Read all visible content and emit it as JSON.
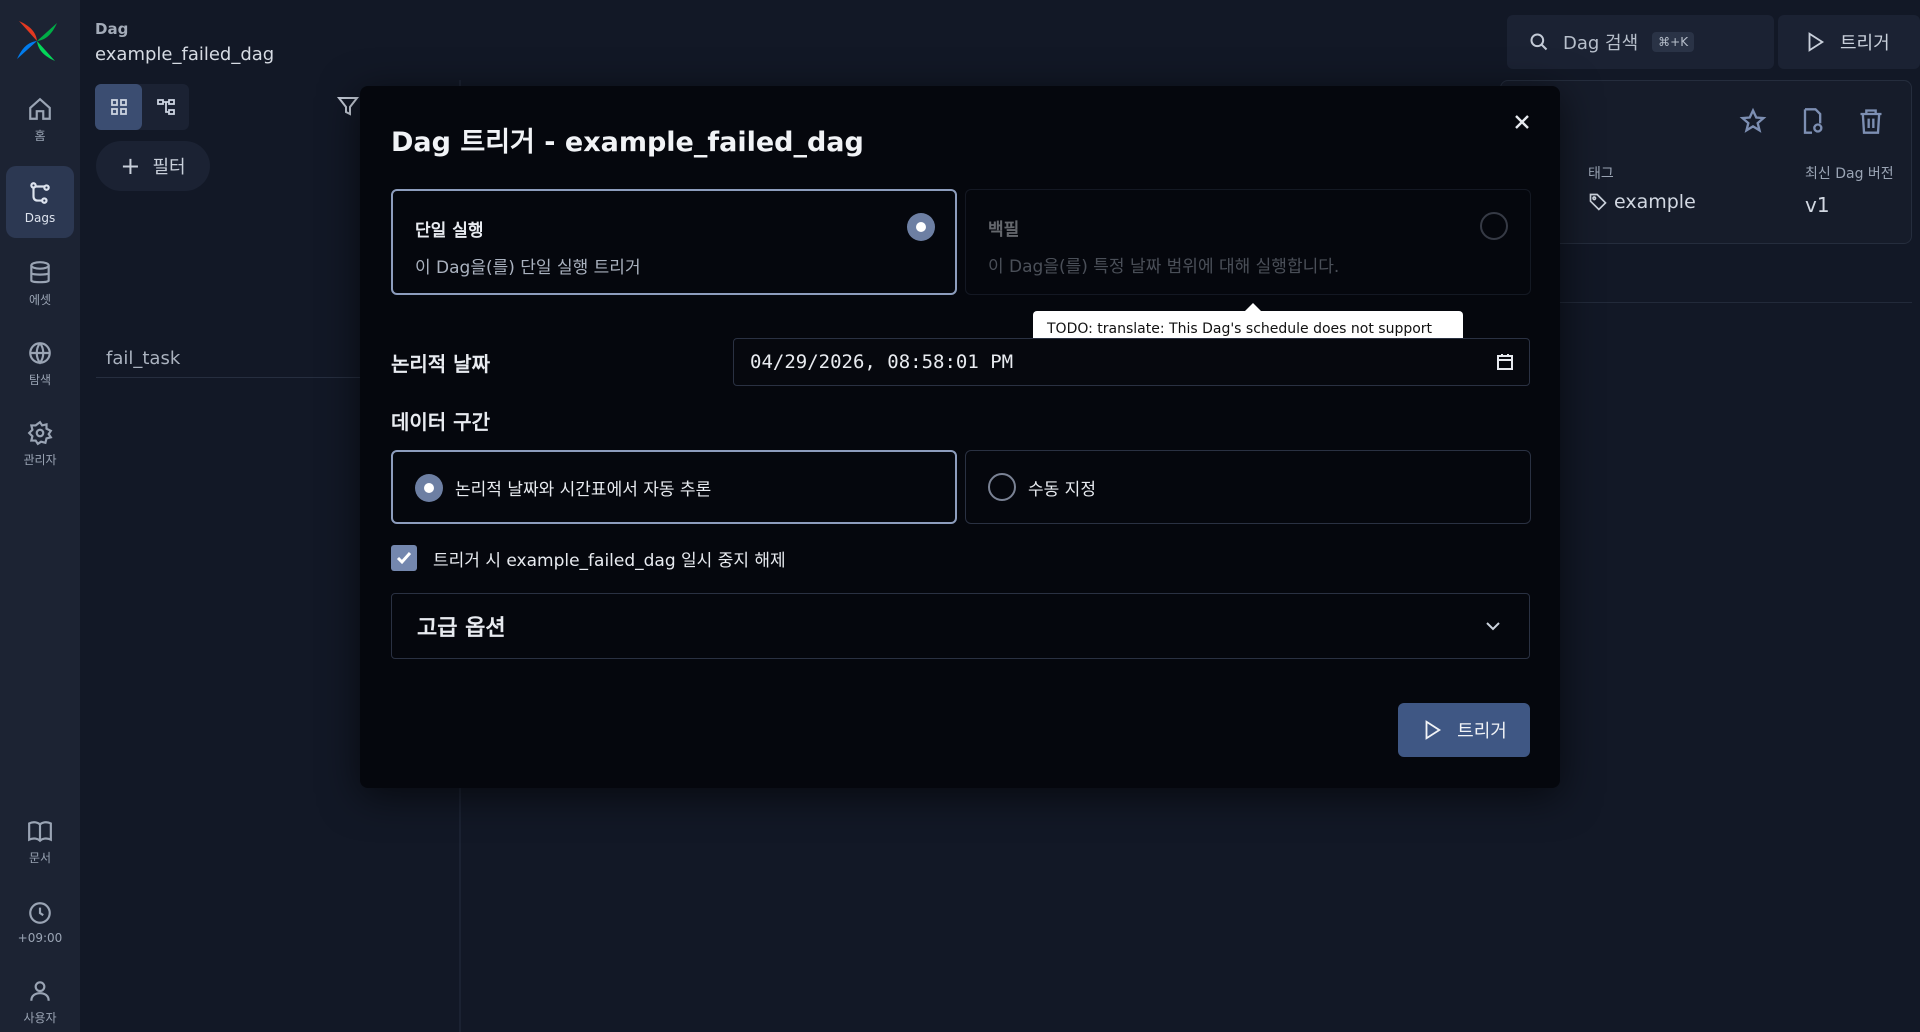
{
  "sidebar": {
    "items": [
      {
        "label": "홈",
        "icon": "home-icon"
      },
      {
        "label": "Dags",
        "icon": "dag-icon"
      },
      {
        "label": "에셋",
        "icon": "database-icon"
      },
      {
        "label": "탐색",
        "icon": "globe-icon"
      },
      {
        "label": "관리자",
        "icon": "gear-icon"
      },
      {
        "label": "문서",
        "icon": "book-icon"
      },
      {
        "label": "+09:00",
        "icon": "clock-icon"
      },
      {
        "label": "사용자",
        "icon": "user-icon"
      }
    ],
    "active": "Dags"
  },
  "header": {
    "breadcrumb_small": "Dag",
    "breadcrumb_dag": "example_failed_dag",
    "search_placeholder": "Dag 검색",
    "search_shortcut": "⌘+K",
    "trigger_label": "트리거"
  },
  "filter": {
    "label": "필터"
  },
  "tasks": [
    "fail_task"
  ],
  "details": {
    "tag_label": "태그",
    "tag_value": "example",
    "version_label": "최신 Dag 버전",
    "version_value": "v1"
  },
  "modal": {
    "title": "Dag 트리거 - example_failed_dag",
    "single_run": {
      "title": "단일 실행",
      "desc": "이 Dag을(를) 단일 실행 트리거",
      "selected": true
    },
    "backfill": {
      "title": "백필",
      "desc": "이 Dag을(를) 특정 날짜 범위에 대해 실행합니다.",
      "disabled": true
    },
    "tooltip": "TODO: translate: This Dag's schedule does not support backfills",
    "logical_date_label": "논리적 날짜",
    "logical_date_value": "04/29/2026, 08:58:01 PM",
    "data_interval_label": "데이터 구간",
    "interval_auto": "논리적 날짜와 시간표에서 자동 추론",
    "interval_manual": "수동 지정",
    "unpause_label": "트리거 시 example_failed_dag 일시 중지 해제",
    "unpause_checked": true,
    "advanced_label": "고급 옵션",
    "submit_label": "트리거"
  },
  "colors": {
    "accent": "#3f5784",
    "sidebar_bg": "#1c2333",
    "modal_bg": "#05070d"
  }
}
